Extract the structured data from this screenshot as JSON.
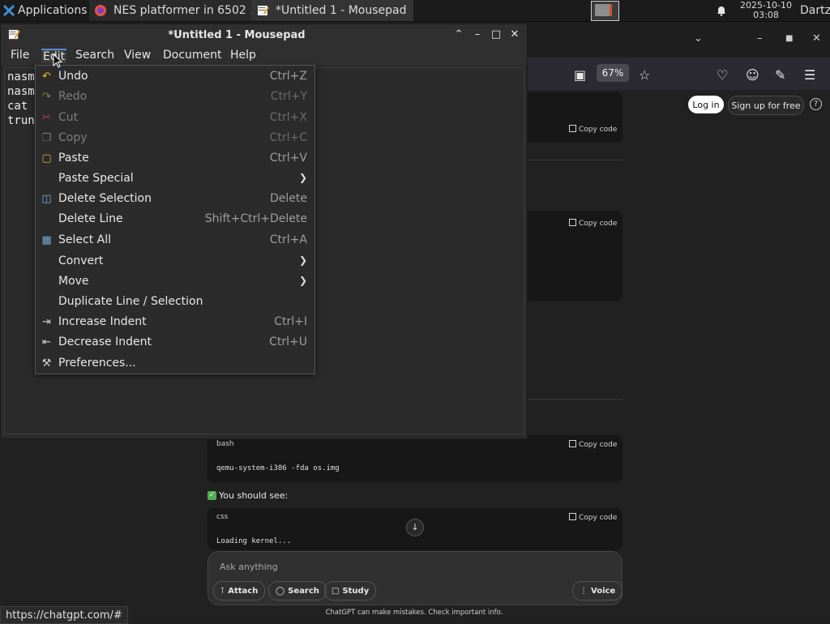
{
  "taskbar": {
    "applications_label": "Applications",
    "tasks": [
      {
        "label": "NES platformer in 6502 ...",
        "icon": "firefox-icon"
      },
      {
        "label": "*Untitled 1 - Mousepad",
        "icon": "mousepad-icon"
      }
    ],
    "clock_date": "2025-10-10",
    "clock_time": "03:08",
    "user": "Dartz"
  },
  "browser": {
    "zoom_level": "67%",
    "login_label": "Log in",
    "signup_label": "Sign up for free",
    "copy_code_label": "Copy code",
    "blocks": [
      {
        "lang": "bash",
        "code": "qemu-system-i386 -fda os.img"
      },
      {
        "lang": "css",
        "code": "Loading kernel..."
      }
    ],
    "you_should_see": "You should see:",
    "composer_placeholder": "Ask anything",
    "composer_buttons": {
      "attach": "Attach",
      "search": "Search",
      "study": "Study",
      "voice": "Voice"
    },
    "disclaimer": "ChatGPT can make mistakes. Check important info.",
    "status_url": "https://chatgpt.com/#"
  },
  "mousepad": {
    "title": "*Untitled 1 - Mousepad",
    "menus": [
      "File",
      "Edit",
      "Search",
      "View",
      "Document",
      "Help"
    ],
    "editor_lines": [
      "nasm",
      "nasm",
      "cat",
      "trun"
    ]
  },
  "edit_menu": {
    "items": [
      {
        "label": "Undo",
        "accel": "Ctrl+Z",
        "icon": "undo-icon",
        "enabled": true
      },
      {
        "label": "Redo",
        "accel": "Ctrl+Y",
        "icon": "redo-icon",
        "enabled": false
      },
      {
        "label": "Cut",
        "accel": "Ctrl+X",
        "icon": "cut-icon",
        "enabled": false
      },
      {
        "label": "Copy",
        "accel": "Ctrl+C",
        "icon": "copy-icon",
        "enabled": false
      },
      {
        "label": "Paste",
        "accel": "Ctrl+V",
        "icon": "paste-icon",
        "enabled": true
      },
      {
        "label": "Paste Special",
        "accel": "",
        "icon": "",
        "enabled": true,
        "submenu": true
      },
      {
        "label": "Delete Selection",
        "accel": "Delete",
        "icon": "delete-icon",
        "enabled": true
      },
      {
        "label": "Delete Line",
        "accel": "Shift+Ctrl+Delete",
        "icon": "",
        "enabled": true
      },
      {
        "label": "Select All",
        "accel": "Ctrl+A",
        "icon": "select-all-icon",
        "enabled": true
      },
      {
        "label": "Convert",
        "accel": "",
        "icon": "",
        "enabled": true,
        "submenu": true
      },
      {
        "label": "Move",
        "accel": "",
        "icon": "",
        "enabled": true,
        "submenu": true
      },
      {
        "label": "Duplicate Line / Selection",
        "accel": "",
        "icon": "",
        "enabled": true
      },
      {
        "label": "Increase Indent",
        "accel": "Ctrl+I",
        "icon": "indent-icon",
        "enabled": true
      },
      {
        "label": "Decrease Indent",
        "accel": "Ctrl+U",
        "icon": "unindent-icon",
        "enabled": true
      },
      {
        "label": "Preferences...",
        "accel": "",
        "icon": "preferences-icon",
        "enabled": true
      }
    ]
  }
}
